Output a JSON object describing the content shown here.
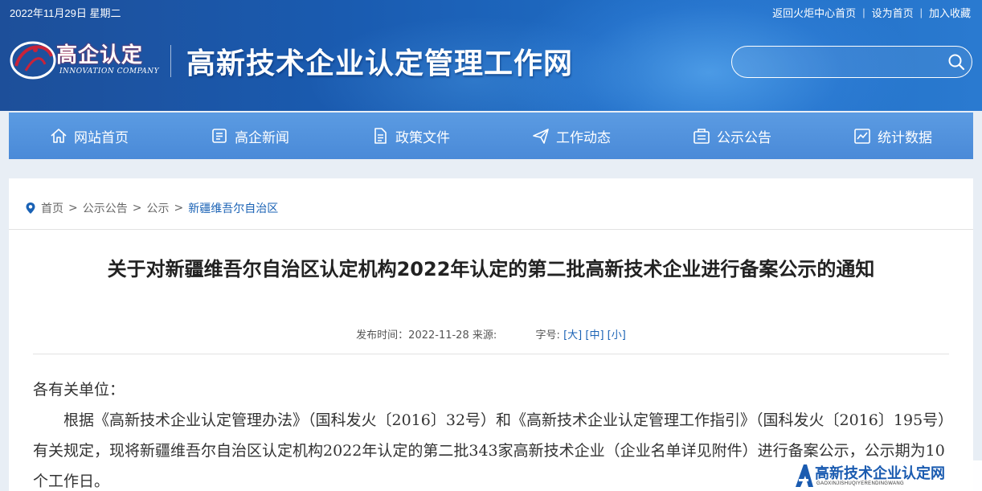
{
  "topbar": {
    "date": "2022年11月29日 星期二",
    "links": [
      "返回火炬中心首页",
      "设为首页",
      "加入收藏"
    ]
  },
  "logo": {
    "text": "高企认定",
    "subtext": "INNOVATION COMPANY"
  },
  "site_title": "高新技术企业认定管理工作网",
  "search": {
    "placeholder": ""
  },
  "nav": [
    {
      "label": "网站首页",
      "icon": "home-icon"
    },
    {
      "label": "高企新闻",
      "icon": "news-icon"
    },
    {
      "label": "政策文件",
      "icon": "document-icon"
    },
    {
      "label": "工作动态",
      "icon": "send-icon"
    },
    {
      "label": "公示公告",
      "icon": "notice-icon"
    },
    {
      "label": "统计数据",
      "icon": "chart-icon"
    }
  ],
  "breadcrumb": {
    "items": [
      "首页",
      "公示公告",
      "公示"
    ],
    "separator": ">",
    "current": "新疆维吾尔自治区"
  },
  "article": {
    "title": "关于对新疆维吾尔自治区认定机构2022年认定的第二批高新技术企业进行备案公示的通知",
    "meta": {
      "published_label": "发布时间：2022-11-28",
      "source_label": "来源:",
      "fontsize_label": "字号:",
      "size_large": "[大]",
      "size_medium": "[中]",
      "size_small": "[小]"
    },
    "greeting": "各有关单位：",
    "paragraph": "根据《高新技术企业认定管理办法》（国科发火〔2016〕32号）和《高新技术企业认定管理工作指引》（国科发火〔2016〕195号）有关规定，现将新疆维吾尔自治区认定机构2022年认定的第二批343家高新技术企业（企业名单详见附件）进行备案公示，公示期为10个工作日。"
  },
  "watermark": {
    "title": "高新技术企业认定网",
    "subtitle": "GAOXINJISHUQIYERENDINGWANG"
  },
  "colors": {
    "header_blue": "#1d4f9a",
    "nav_blue": "#4a8ad8",
    "link_blue": "#1a62b5",
    "logo_red": "#c8233a"
  }
}
